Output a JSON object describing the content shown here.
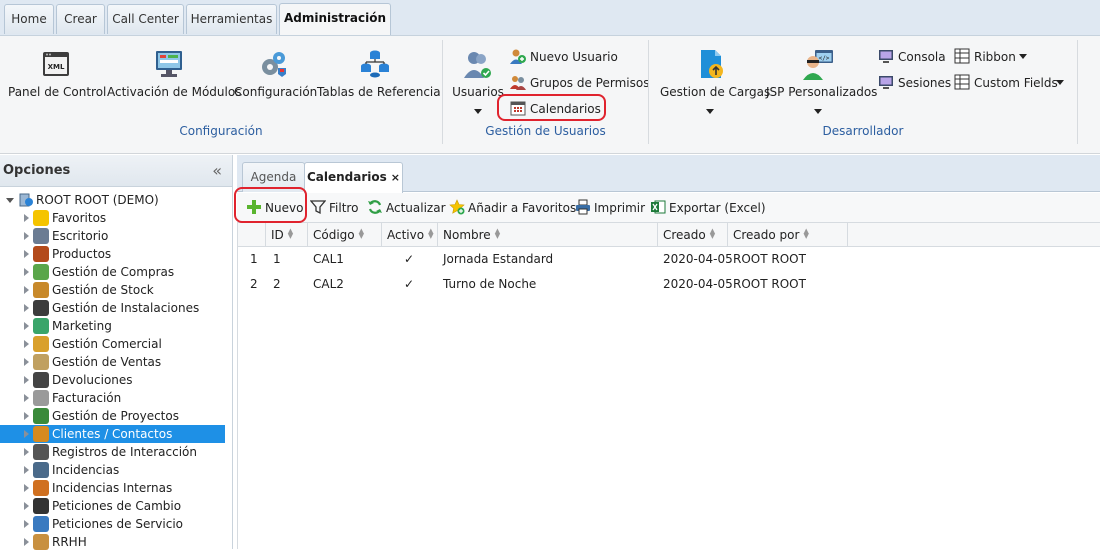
{
  "top_tabs": [
    "Home",
    "Crear",
    "Call Center",
    "Herramientas",
    "Administración"
  ],
  "ribbon": {
    "config_group": {
      "label": "Configuración",
      "buttons": [
        "Panel de Control",
        "Activación de Módulos",
        "Configuración",
        "Tablas de Referencia"
      ],
      "xml_icon_text": "XML"
    },
    "users_group": {
      "label": "Gestión de Usuarios",
      "usuarios": "Usuarios",
      "items": [
        "Nuevo Usuario",
        "Grupos de Permisos",
        "Calendarios"
      ]
    },
    "dev_group": {
      "label": "Desarrollador",
      "buttons": [
        "Gestion de Cargas",
        "JSP Personalizados"
      ],
      "items": [
        "Consola",
        "Sesiones",
        "Ribbon",
        "Custom Fields"
      ]
    }
  },
  "left_panel": {
    "title": "Opciones",
    "collapse_glyph": "«",
    "root": "ROOT ROOT (DEMO)",
    "items": [
      {
        "label": "Favoritos",
        "color": "#f5c400"
      },
      {
        "label": "Escritorio",
        "color": "#6b7c93"
      },
      {
        "label": "Productos",
        "color": "#b34a1b"
      },
      {
        "label": "Gestión de Compras",
        "color": "#5aa64a"
      },
      {
        "label": "Gestión de Stock",
        "color": "#c8892a"
      },
      {
        "label": "Gestión de Instalaciones",
        "color": "#3c3c3c"
      },
      {
        "label": "Marketing",
        "color": "#3aa56a"
      },
      {
        "label": "Gestión Comercial",
        "color": "#d9a02c"
      },
      {
        "label": "Gestión de Ventas",
        "color": "#c0a060"
      },
      {
        "label": "Devoluciones",
        "color": "#444444"
      },
      {
        "label": "Facturación",
        "color": "#9a9a9a"
      },
      {
        "label": "Gestión de Proyectos",
        "color": "#3a8a3a"
      },
      {
        "label": "Clientes / Contactos",
        "color": "#d68a20"
      },
      {
        "label": "Registros de Interacción",
        "color": "#555555"
      },
      {
        "label": "Incidencias",
        "color": "#4a6a8a"
      },
      {
        "label": "Incidencias Internas",
        "color": "#d07020"
      },
      {
        "label": "Peticiones de Cambio",
        "color": "#333333"
      },
      {
        "label": "Peticiones de Servicio",
        "color": "#3a7ac0"
      },
      {
        "label": "RRHH",
        "color": "#c89040"
      }
    ],
    "selected_index": 12
  },
  "content_tabs": [
    {
      "label": "Agenda"
    },
    {
      "label": "Calendarios",
      "close": "×"
    }
  ],
  "toolbar": {
    "nuevo": "Nuevo",
    "filtro": "Filtro",
    "actualizar": "Actualizar",
    "favoritos": "Añadir a Favoritos",
    "imprimir": "Imprimir",
    "exportar": "Exportar (Excel)"
  },
  "grid": {
    "columns": [
      "ID",
      "Código",
      "Activo",
      "Nombre",
      "Creado",
      "Creado por"
    ],
    "rows": [
      {
        "n": "1",
        "id": "1",
        "codigo": "CAL1",
        "activo": "✓",
        "nombre": "Jornada Estandard",
        "creado": "2020-04-05",
        "por": "ROOT ROOT"
      },
      {
        "n": "2",
        "id": "2",
        "codigo": "CAL2",
        "activo": "✓",
        "nombre": "Turno de Noche",
        "creado": "2020-04-05",
        "por": "ROOT ROOT"
      }
    ]
  }
}
